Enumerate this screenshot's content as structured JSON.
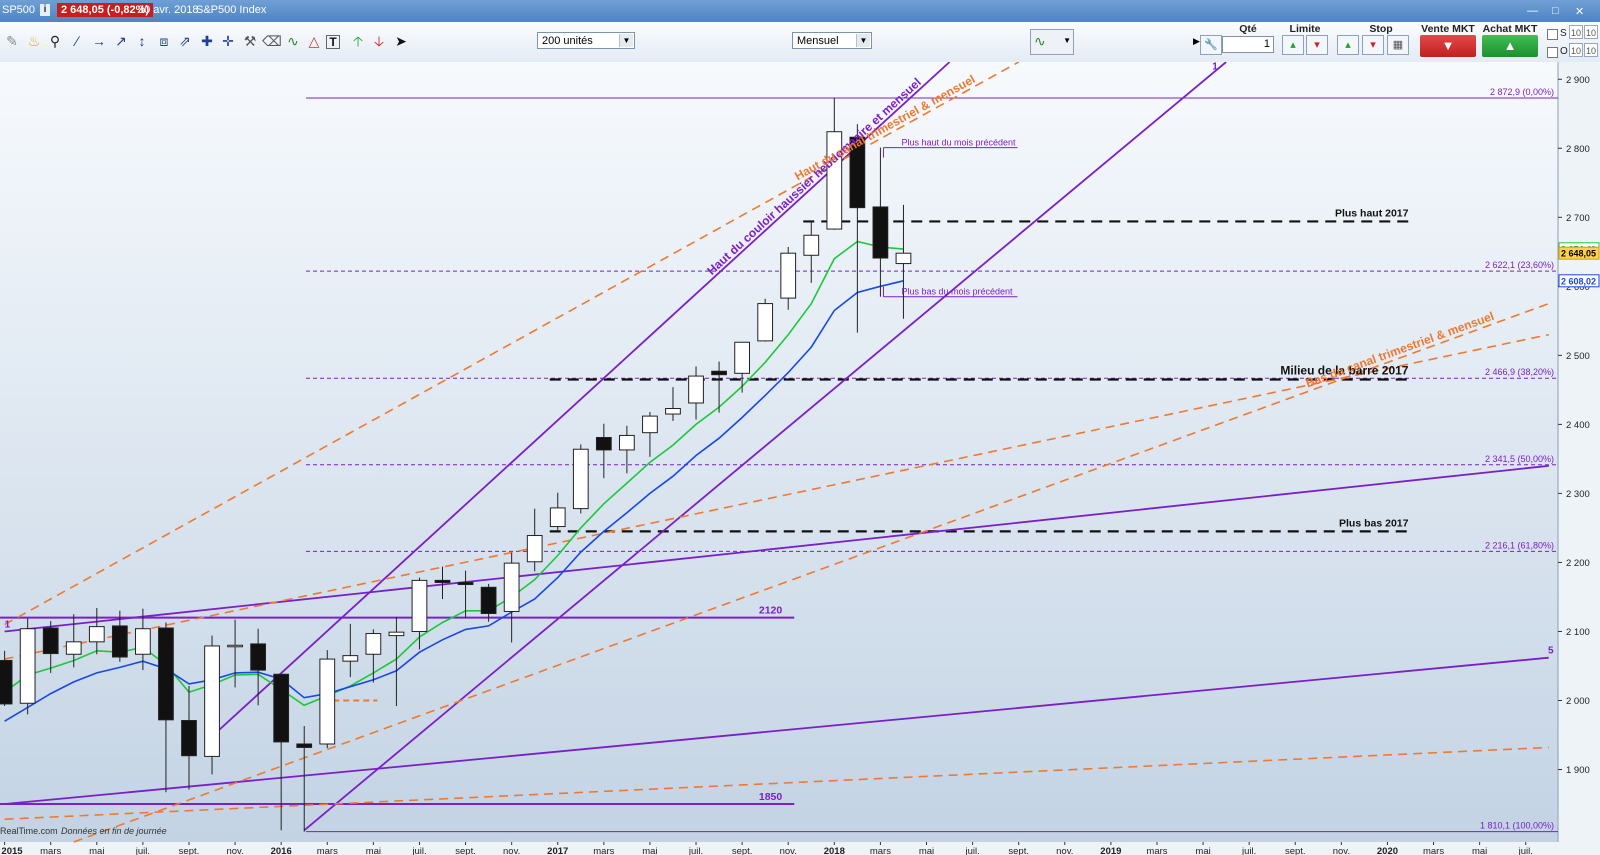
{
  "header": {
    "symbol": "SP500",
    "info": "i",
    "price_change": "2 648,05 (-0,82%)",
    "date": "30 avr. 2018",
    "index_name": "S&P500 Index"
  },
  "toolbar": {
    "units_select": "200 unités",
    "period_select": "Mensuel",
    "qty_label": "Qté",
    "qty_value": "1",
    "limit_label": "Limite",
    "stop_label": "Stop",
    "sell_label": "Vente MKT",
    "buy_label": "Achat MKT",
    "check_s": "S",
    "check_o": "O",
    "pct_a": "10",
    "pct_b": "10",
    "pct_c": "10",
    "pct_d": "10"
  },
  "footer": {
    "source": "RealTime.com",
    "note": "Données en fin de journée"
  },
  "colors": {
    "purple": "#7b1fc8",
    "orange": "#f07830",
    "green": "#1cc83c",
    "blue": "#1848e8",
    "sell_red": "#d42a2a",
    "buy_green": "#26a83a"
  },
  "chart_data": {
    "type": "candlestick",
    "ylim": [
      1795,
      2925
    ],
    "y_ticks": [
      {
        "v": 2900,
        "t": "2 900"
      },
      {
        "v": 2800,
        "t": "2 800"
      },
      {
        "v": 2700,
        "t": "2 700"
      },
      {
        "v": 2600,
        "t": "2 600"
      },
      {
        "v": 2500,
        "t": "2 500"
      },
      {
        "v": 2400,
        "t": "2 400"
      },
      {
        "v": 2300,
        "t": "2 300"
      },
      {
        "v": 2200,
        "t": "2 200"
      },
      {
        "v": 2100,
        "t": "2 100"
      },
      {
        "v": 2000,
        "t": "2 000"
      },
      {
        "v": 1900,
        "t": "1 900"
      }
    ],
    "x_range": [
      "2015-01",
      "2020-08"
    ],
    "x_ticks": [
      {
        "d": "2015-01",
        "t": "2015",
        "bold": true
      },
      {
        "d": "2015-03",
        "t": "mars"
      },
      {
        "d": "2015-05",
        "t": "mai"
      },
      {
        "d": "2015-07",
        "t": "juil."
      },
      {
        "d": "2015-09",
        "t": "sept."
      },
      {
        "d": "2015-11",
        "t": "nov."
      },
      {
        "d": "2016-01",
        "t": "2016",
        "bold": true
      },
      {
        "d": "2016-03",
        "t": "mars"
      },
      {
        "d": "2016-05",
        "t": "mai"
      },
      {
        "d": "2016-07",
        "t": "juil."
      },
      {
        "d": "2016-09",
        "t": "sept."
      },
      {
        "d": "2016-11",
        "t": "nov."
      },
      {
        "d": "2017-01",
        "t": "2017",
        "bold": true
      },
      {
        "d": "2017-03",
        "t": "mars"
      },
      {
        "d": "2017-05",
        "t": "mai"
      },
      {
        "d": "2017-07",
        "t": "juil."
      },
      {
        "d": "2017-09",
        "t": "sept."
      },
      {
        "d": "2017-11",
        "t": "nov."
      },
      {
        "d": "2018-01",
        "t": "2018",
        "bold": true
      },
      {
        "d": "2018-03",
        "t": "mars"
      },
      {
        "d": "2018-05",
        "t": "mai"
      },
      {
        "d": "2018-07",
        "t": "juil."
      },
      {
        "d": "2018-09",
        "t": "sept."
      },
      {
        "d": "2018-11",
        "t": "nov."
      },
      {
        "d": "2019-01",
        "t": "2019",
        "bold": true
      },
      {
        "d": "2019-03",
        "t": "mars"
      },
      {
        "d": "2019-05",
        "t": "mai"
      },
      {
        "d": "2019-07",
        "t": "juil."
      },
      {
        "d": "2019-09",
        "t": "sept."
      },
      {
        "d": "2019-11",
        "t": "nov."
      },
      {
        "d": "2020-01",
        "t": "2020",
        "bold": true
      },
      {
        "d": "2020-03",
        "t": "mars"
      },
      {
        "d": "2020-05",
        "t": "mai"
      },
      {
        "d": "2020-07",
        "t": "juil."
      }
    ],
    "candles": [
      {
        "d": "2015-01",
        "o": 2058,
        "h": 2072,
        "l": 1992,
        "c": 1995
      },
      {
        "d": "2015-02",
        "o": 1996,
        "h": 2119,
        "l": 1980,
        "c": 2104
      },
      {
        "d": "2015-03",
        "o": 2105,
        "h": 2115,
        "l": 2040,
        "c": 2068
      },
      {
        "d": "2015-04",
        "o": 2067,
        "h": 2125,
        "l": 2048,
        "c": 2085
      },
      {
        "d": "2015-05",
        "o": 2085,
        "h": 2134,
        "l": 2067,
        "c": 2107
      },
      {
        "d": "2015-06",
        "o": 2108,
        "h": 2130,
        "l": 2056,
        "c": 2063
      },
      {
        "d": "2015-07",
        "o": 2067,
        "h": 2133,
        "l": 2044,
        "c": 2104
      },
      {
        "d": "2015-08",
        "o": 2105,
        "h": 2113,
        "l": 1867,
        "c": 1972
      },
      {
        "d": "2015-09",
        "o": 1971,
        "h": 2021,
        "l": 1871,
        "c": 1920
      },
      {
        "d": "2015-10",
        "o": 1919,
        "h": 2094,
        "l": 1893,
        "c": 2079
      },
      {
        "d": "2015-11",
        "o": 2080,
        "h": 2117,
        "l": 2019,
        "c": 2080
      },
      {
        "d": "2015-12",
        "o": 2082,
        "h": 2104,
        "l": 1993,
        "c": 2044
      },
      {
        "d": "2016-01",
        "o": 2038,
        "h": 2038,
        "l": 1812,
        "c": 1940
      },
      {
        "d": "2016-02",
        "o": 1937,
        "h": 1963,
        "l": 1810,
        "c": 1932
      },
      {
        "d": "2016-03",
        "o": 1937,
        "h": 2073,
        "l": 1931,
        "c": 2060
      },
      {
        "d": "2016-04",
        "o": 2057,
        "h": 2111,
        "l": 2034,
        "c": 2065
      },
      {
        "d": "2016-05",
        "o": 2067,
        "h": 2103,
        "l": 2026,
        "c": 2097
      },
      {
        "d": "2016-06",
        "o": 2094,
        "h": 2121,
        "l": 1992,
        "c": 2099
      },
      {
        "d": "2016-07",
        "o": 2100,
        "h": 2178,
        "l": 2074,
        "c": 2174
      },
      {
        "d": "2016-08",
        "o": 2174,
        "h": 2194,
        "l": 2147,
        "c": 2171
      },
      {
        "d": "2016-09",
        "o": 2171,
        "h": 2188,
        "l": 2119,
        "c": 2168
      },
      {
        "d": "2016-10",
        "o": 2164,
        "h": 2169,
        "l": 2114,
        "c": 2126
      },
      {
        "d": "2016-11",
        "o": 2129,
        "h": 2214,
        "l": 2084,
        "c": 2199
      },
      {
        "d": "2016-12",
        "o": 2201,
        "h": 2278,
        "l": 2187,
        "c": 2239
      },
      {
        "d": "2017-01",
        "o": 2252,
        "h": 2301,
        "l": 2245,
        "c": 2279
      },
      {
        "d": "2017-02",
        "o": 2278,
        "h": 2371,
        "l": 2271,
        "c": 2364
      },
      {
        "d": "2017-03",
        "o": 2381,
        "h": 2401,
        "l": 2322,
        "c": 2363
      },
      {
        "d": "2017-04",
        "o": 2363,
        "h": 2398,
        "l": 2329,
        "c": 2384
      },
      {
        "d": "2017-05",
        "o": 2388,
        "h": 2418,
        "l": 2353,
        "c": 2412
      },
      {
        "d": "2017-06",
        "o": 2415,
        "h": 2454,
        "l": 2405,
        "c": 2423
      },
      {
        "d": "2017-07",
        "o": 2431,
        "h": 2484,
        "l": 2407,
        "c": 2470
      },
      {
        "d": "2017-08",
        "o": 2477,
        "h": 2491,
        "l": 2417,
        "c": 2472
      },
      {
        "d": "2017-09",
        "o": 2474,
        "h": 2519,
        "l": 2446,
        "c": 2519
      },
      {
        "d": "2017-10",
        "o": 2521,
        "h": 2582,
        "l": 2520,
        "c": 2575
      },
      {
        "d": "2017-11",
        "o": 2583,
        "h": 2657,
        "l": 2566,
        "c": 2648
      },
      {
        "d": "2017-12",
        "o": 2645,
        "h": 2695,
        "l": 2605,
        "c": 2674
      },
      {
        "d": "2018-01",
        "o": 2683,
        "h": 2873,
        "l": 2682,
        "c": 2824
      },
      {
        "d": "2018-02",
        "o": 2816,
        "h": 2835,
        "l": 2533,
        "c": 2714
      },
      {
        "d": "2018-03",
        "o": 2715,
        "h": 2801,
        "l": 2585,
        "c": 2641
      },
      {
        "d": "2018-04",
        "o": 2633,
        "h": 2718,
        "l": 2553,
        "c": 2648
      }
    ],
    "series": [
      {
        "name": "",
        "color": "#1cc83c",
        "values": [
          [
            "2015-01",
            2012
          ],
          [
            "2015-02",
            2037
          ],
          [
            "2015-03",
            2047
          ],
          [
            "2015-04",
            2058
          ],
          [
            "2015-05",
            2072
          ],
          [
            "2015-06",
            2070
          ],
          [
            "2015-07",
            2077
          ],
          [
            "2015-08",
            2052
          ],
          [
            "2015-09",
            2012
          ],
          [
            "2015-10",
            2023
          ],
          [
            "2015-11",
            2037
          ],
          [
            "2015-12",
            2038
          ],
          [
            "2016-01",
            2016
          ],
          [
            "2016-02",
            1993
          ],
          [
            "2016-03",
            2007
          ],
          [
            "2016-04",
            2021
          ],
          [
            "2016-05",
            2040
          ],
          [
            "2016-06",
            2060
          ],
          [
            "2016-07",
            2092
          ],
          [
            "2016-08",
            2113
          ],
          [
            "2016-09",
            2130
          ],
          [
            "2016-10",
            2130
          ],
          [
            "2016-11",
            2150
          ],
          [
            "2016-12",
            2175
          ],
          [
            "2017-01",
            2210
          ],
          [
            "2017-02",
            2250
          ],
          [
            "2017-03",
            2285
          ],
          [
            "2017-04",
            2315
          ],
          [
            "2017-05",
            2345
          ],
          [
            "2017-06",
            2370
          ],
          [
            "2017-07",
            2400
          ],
          [
            "2017-08",
            2425
          ],
          [
            "2017-09",
            2455
          ],
          [
            "2017-10",
            2490
          ],
          [
            "2017-11",
            2530
          ],
          [
            "2017-12",
            2575
          ],
          [
            "2018-01",
            2640
          ],
          [
            "2018-02",
            2665
          ],
          [
            "2018-03",
            2657
          ],
          [
            "2018-04",
            2654
          ]
        ]
      },
      {
        "name": "",
        "color": "#1848e8",
        "values": [
          [
            "2015-01",
            1970
          ],
          [
            "2015-02",
            1990
          ],
          [
            "2015-03",
            2010
          ],
          [
            "2015-04",
            2027
          ],
          [
            "2015-05",
            2040
          ],
          [
            "2015-06",
            2048
          ],
          [
            "2015-07",
            2057
          ],
          [
            "2015-08",
            2046
          ],
          [
            "2015-09",
            2024
          ],
          [
            "2015-10",
            2030
          ],
          [
            "2015-11",
            2040
          ],
          [
            "2015-12",
            2041
          ],
          [
            "2016-01",
            2031
          ],
          [
            "2016-02",
            2004
          ],
          [
            "2016-03",
            2010
          ],
          [
            "2016-04",
            2020
          ],
          [
            "2016-05",
            2030
          ],
          [
            "2016-06",
            2043
          ],
          [
            "2016-07",
            2070
          ],
          [
            "2016-08",
            2088
          ],
          [
            "2016-09",
            2103
          ],
          [
            "2016-10",
            2108
          ],
          [
            "2016-11",
            2128
          ],
          [
            "2016-12",
            2147
          ],
          [
            "2017-01",
            2178
          ],
          [
            "2017-02",
            2215
          ],
          [
            "2017-03",
            2245
          ],
          [
            "2017-04",
            2272
          ],
          [
            "2017-05",
            2300
          ],
          [
            "2017-06",
            2325
          ],
          [
            "2017-07",
            2355
          ],
          [
            "2017-08",
            2380
          ],
          [
            "2017-09",
            2410
          ],
          [
            "2017-10",
            2442
          ],
          [
            "2017-11",
            2475
          ],
          [
            "2017-12",
            2512
          ],
          [
            "2018-01",
            2565
          ],
          [
            "2018-02",
            2591
          ],
          [
            "2018-03",
            2600
          ],
          [
            "2018-04",
            2608
          ]
        ]
      }
    ],
    "horizontal_levels": [
      {
        "v": 2872.9,
        "label": "2 872,9 (0,00%)",
        "style": "fib"
      },
      {
        "v": 2622.1,
        "label": "2 622,1 (23,60%)",
        "style": "fib"
      },
      {
        "v": 2466.9,
        "label": "2 466,9 (38,20%)",
        "style": "fib"
      },
      {
        "v": 2341.5,
        "label": "2 341,5 (50,00%)",
        "style": "fib"
      },
      {
        "v": 2216.1,
        "label": "2 216,1 (61,80%)",
        "style": "fib"
      },
      {
        "v": 1810.1,
        "label": "1 810,1 (100,00%)",
        "style": "fib"
      }
    ],
    "black_levels": [
      {
        "v": 2694,
        "from": "2017-12",
        "to": "2020-02",
        "label": "Plus haut 2017"
      },
      {
        "v": 2465,
        "from": "2017-01",
        "to": "2020-02",
        "label": "Milieu de la barre 2017"
      },
      {
        "v": 2245,
        "from": "2017-01",
        "to": "2020-02",
        "label": "Plus bas 2017"
      }
    ],
    "support_levels": [
      {
        "v": 2120,
        "from": "2015-01",
        "to": "2017-11",
        "label": "2120"
      },
      {
        "v": 1850,
        "from": "2015-01",
        "to": "2017-11",
        "label": "1850"
      }
    ],
    "prev_month": [
      {
        "v": 2801,
        "label": "Plus haut du mois précédent"
      },
      {
        "v": 2585,
        "label": "Plus bas du mois précédent"
      }
    ],
    "orange_short": {
      "v": 2000,
      "from": "2016-03",
      "to": "2016-05"
    },
    "trendlines": [
      {
        "color": "#7b1fc8",
        "dash": false,
        "from": [
          "2015-10",
          1948
        ],
        "to": [
          "2018-06",
          2925
        ],
        "label": "Haut du couloir haussier hebdomaaire et mensuel",
        "label_at": 0.82
      },
      {
        "color": "#7b1fc8",
        "dash": false,
        "from": [
          "2016-02",
          1812
        ],
        "to": [
          "2019-06",
          2925
        ],
        "label": "1",
        "label_at": 0.985
      },
      {
        "color": "#7b1fc8",
        "dash": false,
        "from": [
          "2015-01",
          2100
        ],
        "to": [
          "2020-08",
          2340
        ],
        "label": "1",
        "label_at": 0.0
      },
      {
        "color": "#7b1fc8",
        "dash": false,
        "from": [
          "2015-01",
          1850
        ],
        "to": [
          "2020-08",
          2062
        ],
        "label": "5",
        "label_at": 1.0
      },
      {
        "color": "#f07830",
        "dash": true,
        "from": [
          "2015-01",
          2110
        ],
        "to": [
          "2018-09",
          2925
        ],
        "label": "Haut du canal trimestriel & mensuel",
        "label_at": 0.87
      },
      {
        "color": "#f07830",
        "dash": true,
        "from": [
          "2015-01",
          2060
        ],
        "to": [
          "2020-08",
          2530
        ],
        "label": "",
        "label_at": 0
      },
      {
        "color": "#f07830",
        "dash": true,
        "from": [
          "2015-04",
          1795
        ],
        "to": [
          "2020-08",
          2575
        ],
        "label": "Bas du canal trimestriel & mensuel",
        "label_at": 0.9
      },
      {
        "color": "#f07830",
        "dash": true,
        "from": [
          "2015-01",
          1828
        ],
        "to": [
          "2020-08",
          1932
        ],
        "label": "",
        "label_at": 0
      }
    ],
    "price_tags": [
      {
        "v": 2654.4,
        "t": "2 654,40",
        "bg": "#ffffff",
        "fg": "#13a02c",
        "border": "#1cc83c"
      },
      {
        "v": 2648.05,
        "t": "2 648,05",
        "bg": "#ffd24a",
        "fg": "#000000",
        "border": "#c9a000"
      },
      {
        "v": 2608.02,
        "t": "2 608,02",
        "bg": "#ffffff",
        "fg": "#1848e8",
        "border": "#1848e8"
      }
    ]
  }
}
